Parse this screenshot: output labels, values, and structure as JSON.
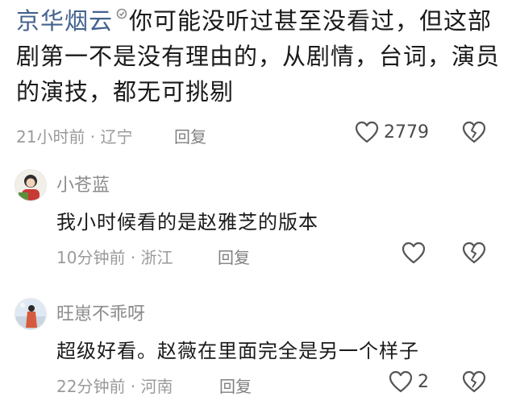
{
  "comments": [
    {
      "author": "京华烟云",
      "text": "你可能没听过甚至没看过，但这部剧第一不是没有理由的，从剧情，台词，演员的演技，都无可挑剔",
      "time_location": "21小时前 · 辽宁",
      "reply_label": "回复",
      "like_count": "2779",
      "author_color": "#43628f"
    }
  ],
  "replies": [
    {
      "name": "小苍蓝",
      "text": "我小时候看的是赵雅芝的版本",
      "time_location": "10分钟前 · 浙江",
      "reply_label": "回复",
      "like_count": ""
    },
    {
      "name": "旺崽不乖呀",
      "text": "超级好看。赵薇在里面完全是另一个样子",
      "time_location": "22分钟前 · 河南",
      "reply_label": "回复",
      "like_count": "2"
    }
  ],
  "icons": {
    "like": "heart-outline-icon",
    "dislike": "broken-heart-icon",
    "badge": "badge-icon"
  }
}
